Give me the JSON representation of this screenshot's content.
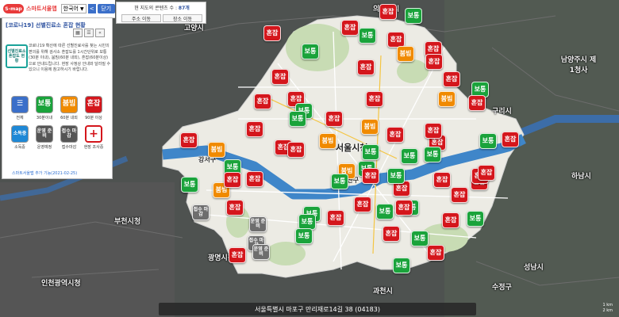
{
  "header": {
    "logo_text": "S-map",
    "app_name": "스마트서울맵",
    "lang_selected": "한국어",
    "prev_label": "<",
    "close_label": "닫기"
  },
  "panel": {
    "title": "[코로나19] 선별진료소 혼잡 현황",
    "badge_text": "선별진료소 혼잡도 현황",
    "description": "코로나19 확산에 따른 선별진료사를 찾는 시민의 편의를 위해 검사소 혼잡도를 1시간단위로 보통(30분 이내), 붐빔(60분 내외), 혼잡(60분이상)으로 안내드립니다. 현장 사정상 안내와 달라질 수 있으니 이용에 참고하시기 바랍니다.",
    "legend": [
      {
        "key": "all",
        "label": "",
        "caption": "전체",
        "color": "#3b6fc9"
      },
      {
        "key": "normal",
        "label": "보통",
        "caption": "30분이내",
        "color": "#1aa33b"
      },
      {
        "key": "busy",
        "label": "붐빔",
        "caption": "60분 내외",
        "color": "#f08a00"
      },
      {
        "key": "crowded",
        "label": "혼잡",
        "caption": "90분 이상",
        "color": "#d4161c"
      },
      {
        "key": "small",
        "label": "소독중",
        "caption": "소독중",
        "color": "#1e88d6"
      },
      {
        "key": "prep",
        "label": "운영 준비",
        "caption": "운영예정",
        "color": "#555555"
      },
      {
        "key": "closed",
        "label": "접수 마감",
        "caption": "접수마감",
        "color": "#555555"
      },
      {
        "key": "survey",
        "label": "+",
        "caption": "현장 조사중",
        "color": "#d4161c"
      }
    ],
    "updated": "스마트서울맵 추가 기능(2021-02-25)"
  },
  "infobar": {
    "line_prefix": "현 지도의 콘텐츠 수 :",
    "count": "87개",
    "tab1": "주소 이동",
    "tab2": "장소 이동"
  },
  "address": "서울특별시 마포구 만리재로14길 38 (04183)",
  "scale": {
    "top": "1 km",
    "bottom": "2 km"
  },
  "map_labels": [
    {
      "text": "고양시",
      "cls": ""
    },
    {
      "text": "의정부시",
      "cls": ""
    },
    {
      "text": "남양주시 제1청사",
      "cls": ""
    },
    {
      "text": "구리시",
      "cls": ""
    },
    {
      "text": "하남시",
      "cls": ""
    },
    {
      "text": "부천시청",
      "cls": ""
    },
    {
      "text": "광명시청",
      "cls": ""
    },
    {
      "text": "인천광역시청",
      "cls": ""
    },
    {
      "text": "서울시청",
      "cls": "big"
    },
    {
      "text": "용산구",
      "cls": "inner"
    },
    {
      "text": "강서구",
      "cls": "inner"
    },
    {
      "text": "과천시",
      "cls": ""
    },
    {
      "text": "성남시",
      "cls": ""
    },
    {
      "text": "수정구",
      "cls": ""
    }
  ],
  "pins": [
    {
      "t": "혼잡",
      "c": "red"
    },
    {
      "t": "혼잡",
      "c": "red"
    },
    {
      "t": "보통",
      "c": "green"
    },
    {
      "t": "혼잡",
      "c": "red"
    },
    {
      "t": "보통",
      "c": "green"
    },
    {
      "t": "혼잡",
      "c": "red"
    },
    {
      "t": "붐빔",
      "c": "orange"
    },
    {
      "t": "혼잡",
      "c": "red"
    },
    {
      "t": "혼잡",
      "c": "red"
    },
    {
      "t": "보통",
      "c": "green"
    },
    {
      "t": "혼잡",
      "c": "red"
    },
    {
      "t": "혼잡",
      "c": "red"
    },
    {
      "t": "붐빔",
      "c": "orange"
    },
    {
      "t": "혼잡",
      "c": "red"
    },
    {
      "t": "보통",
      "c": "green"
    },
    {
      "t": "혼잡",
      "c": "red"
    },
    {
      "t": "보통",
      "c": "green"
    },
    {
      "t": "혼잡",
      "c": "red"
    },
    {
      "t": "붐빔",
      "c": "orange"
    },
    {
      "t": "혼잡",
      "c": "red"
    },
    {
      "t": "보통",
      "c": "green"
    },
    {
      "t": "혼잡",
      "c": "red"
    },
    {
      "t": "혼잡",
      "c": "red"
    },
    {
      "t": "붐빔",
      "c": "orange"
    },
    {
      "t": "혼잡",
      "c": "red"
    },
    {
      "t": "보통",
      "c": "green"
    },
    {
      "t": "혼잡",
      "c": "red"
    },
    {
      "t": "보통",
      "c": "green"
    },
    {
      "t": "보통",
      "c": "green"
    },
    {
      "t": "혼잡",
      "c": "red"
    },
    {
      "t": "혼잡",
      "c": "red"
    },
    {
      "t": "붐빔",
      "c": "orange"
    },
    {
      "t": "보통",
      "c": "green"
    },
    {
      "t": "혼잡",
      "c": "red"
    },
    {
      "t": "혼잡",
      "c": "red"
    },
    {
      "t": "보통",
      "c": "green"
    },
    {
      "t": "혼잡",
      "c": "red"
    },
    {
      "t": "보통",
      "c": "green"
    },
    {
      "t": "혼잡",
      "c": "red"
    },
    {
      "t": "붐빔",
      "c": "orange"
    },
    {
      "t": "보통",
      "c": "green"
    },
    {
      "t": "혼잡",
      "c": "red"
    },
    {
      "t": "혼잡",
      "c": "red"
    },
    {
      "t": "보통",
      "c": "green"
    },
    {
      "t": "혼잡",
      "c": "red"
    },
    {
      "t": "보통",
      "c": "green"
    },
    {
      "t": "혼잡",
      "c": "red"
    },
    {
      "t": "보통",
      "c": "green"
    },
    {
      "t": "혼잡",
      "c": "red"
    },
    {
      "t": "혼잡",
      "c": "red"
    },
    {
      "t": "보통",
      "c": "green"
    },
    {
      "t": "혼잡",
      "c": "red"
    },
    {
      "t": "보통",
      "c": "green"
    },
    {
      "t": "혼잡",
      "c": "red"
    },
    {
      "t": "혼잡",
      "c": "red"
    },
    {
      "t": "보통",
      "c": "green"
    },
    {
      "t": "혼잡",
      "c": "red"
    },
    {
      "t": "보통",
      "c": "green"
    },
    {
      "t": "혼잡",
      "c": "red"
    },
    {
      "t": "혼잡",
      "c": "red"
    },
    {
      "t": "접수 마감",
      "c": "gray"
    },
    {
      "t": "운영 준비",
      "c": "gray"
    },
    {
      "t": "접수 마감",
      "c": "gray"
    },
    {
      "t": "운영 준비",
      "c": "gray"
    },
    {
      "t": "붐빔",
      "c": "orange"
    },
    {
      "t": "보통",
      "c": "green"
    },
    {
      "t": "혼잡",
      "c": "red"
    },
    {
      "t": "보통",
      "c": "green"
    },
    {
      "t": "혼잡",
      "c": "red"
    },
    {
      "t": "혼잡",
      "c": "red"
    },
    {
      "t": "보통",
      "c": "green"
    },
    {
      "t": "혼잡",
      "c": "red"
    },
    {
      "t": "혼잡",
      "c": "red"
    }
  ]
}
